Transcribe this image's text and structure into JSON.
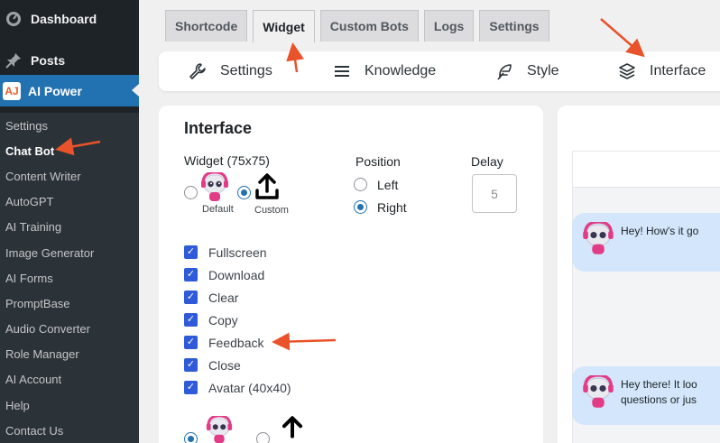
{
  "sidebar": {
    "dashboard": "Dashboard",
    "posts": "Posts",
    "ai_power": "AI Power",
    "ai_power_logo": "AJ",
    "submenu": [
      {
        "label": "Settings"
      },
      {
        "label": "Chat Bot"
      },
      {
        "label": "Content Writer"
      },
      {
        "label": "AutoGPT"
      },
      {
        "label": "AI Training"
      },
      {
        "label": "Image Generator"
      },
      {
        "label": "AI Forms"
      },
      {
        "label": "PromptBase"
      },
      {
        "label": "Audio Converter"
      },
      {
        "label": "Role Manager"
      },
      {
        "label": "AI Account"
      },
      {
        "label": "Help"
      },
      {
        "label": "Contact Us"
      }
    ],
    "current": "Chat Bot"
  },
  "tabs": [
    {
      "label": "Shortcode"
    },
    {
      "label": "Widget"
    },
    {
      "label": "Custom Bots"
    },
    {
      "label": "Logs"
    },
    {
      "label": "Settings"
    }
  ],
  "active_tab": "Widget",
  "subnav": {
    "settings": "Settings",
    "knowledge": "Knowledge",
    "style": "Style",
    "interface": "Interface"
  },
  "panel": {
    "title": "Interface",
    "widget_label": "Widget (75x75)",
    "default_label": "Default",
    "custom_label": "Custom",
    "position_label": "Position",
    "left_label": "Left",
    "right_label": "Right",
    "delay_label": "Delay",
    "delay_placeholder": "5",
    "checkboxes": [
      {
        "label": "Fullscreen",
        "checked": true
      },
      {
        "label": "Download",
        "checked": true
      },
      {
        "label": "Clear",
        "checked": true
      },
      {
        "label": "Copy",
        "checked": true
      },
      {
        "label": "Feedback",
        "checked": true
      },
      {
        "label": "Close",
        "checked": true
      },
      {
        "label": "Avatar (40x40)",
        "checked": true
      }
    ]
  },
  "preview": {
    "msg1": "Hey! How's it go",
    "msg2_line1": "Hey there! It loo",
    "msg2_line2": "questions or jus"
  },
  "colors": {
    "sidebar_bg": "#1d2327",
    "accent": "#2271b1",
    "checkbox": "#2f5bd8",
    "bubble": "#d3e6fb",
    "annotation_arrow": "#e8532b"
  }
}
